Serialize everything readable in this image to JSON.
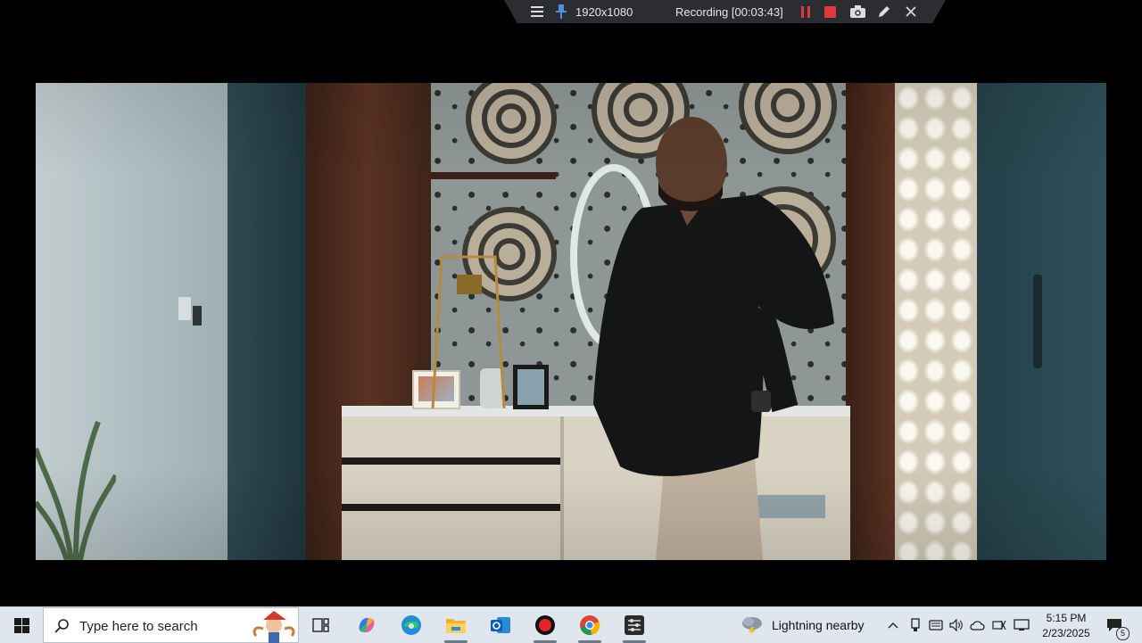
{
  "recorder": {
    "resolution": "1920x1080",
    "status": "Recording [00:03:43]",
    "colors": {
      "pause": "#e0383b",
      "stop": "#e0383b",
      "bar": "#2b2d31"
    }
  },
  "taskbar": {
    "search_placeholder": "Type here to search",
    "weather": "Lightning nearby",
    "time": "5:15 PM",
    "date": "2/23/2025",
    "notifications_count": "5",
    "apps": [
      "task-view",
      "copilot",
      "edge",
      "file-explorer",
      "outlook",
      "recorder",
      "chrome",
      "settings-app"
    ]
  }
}
